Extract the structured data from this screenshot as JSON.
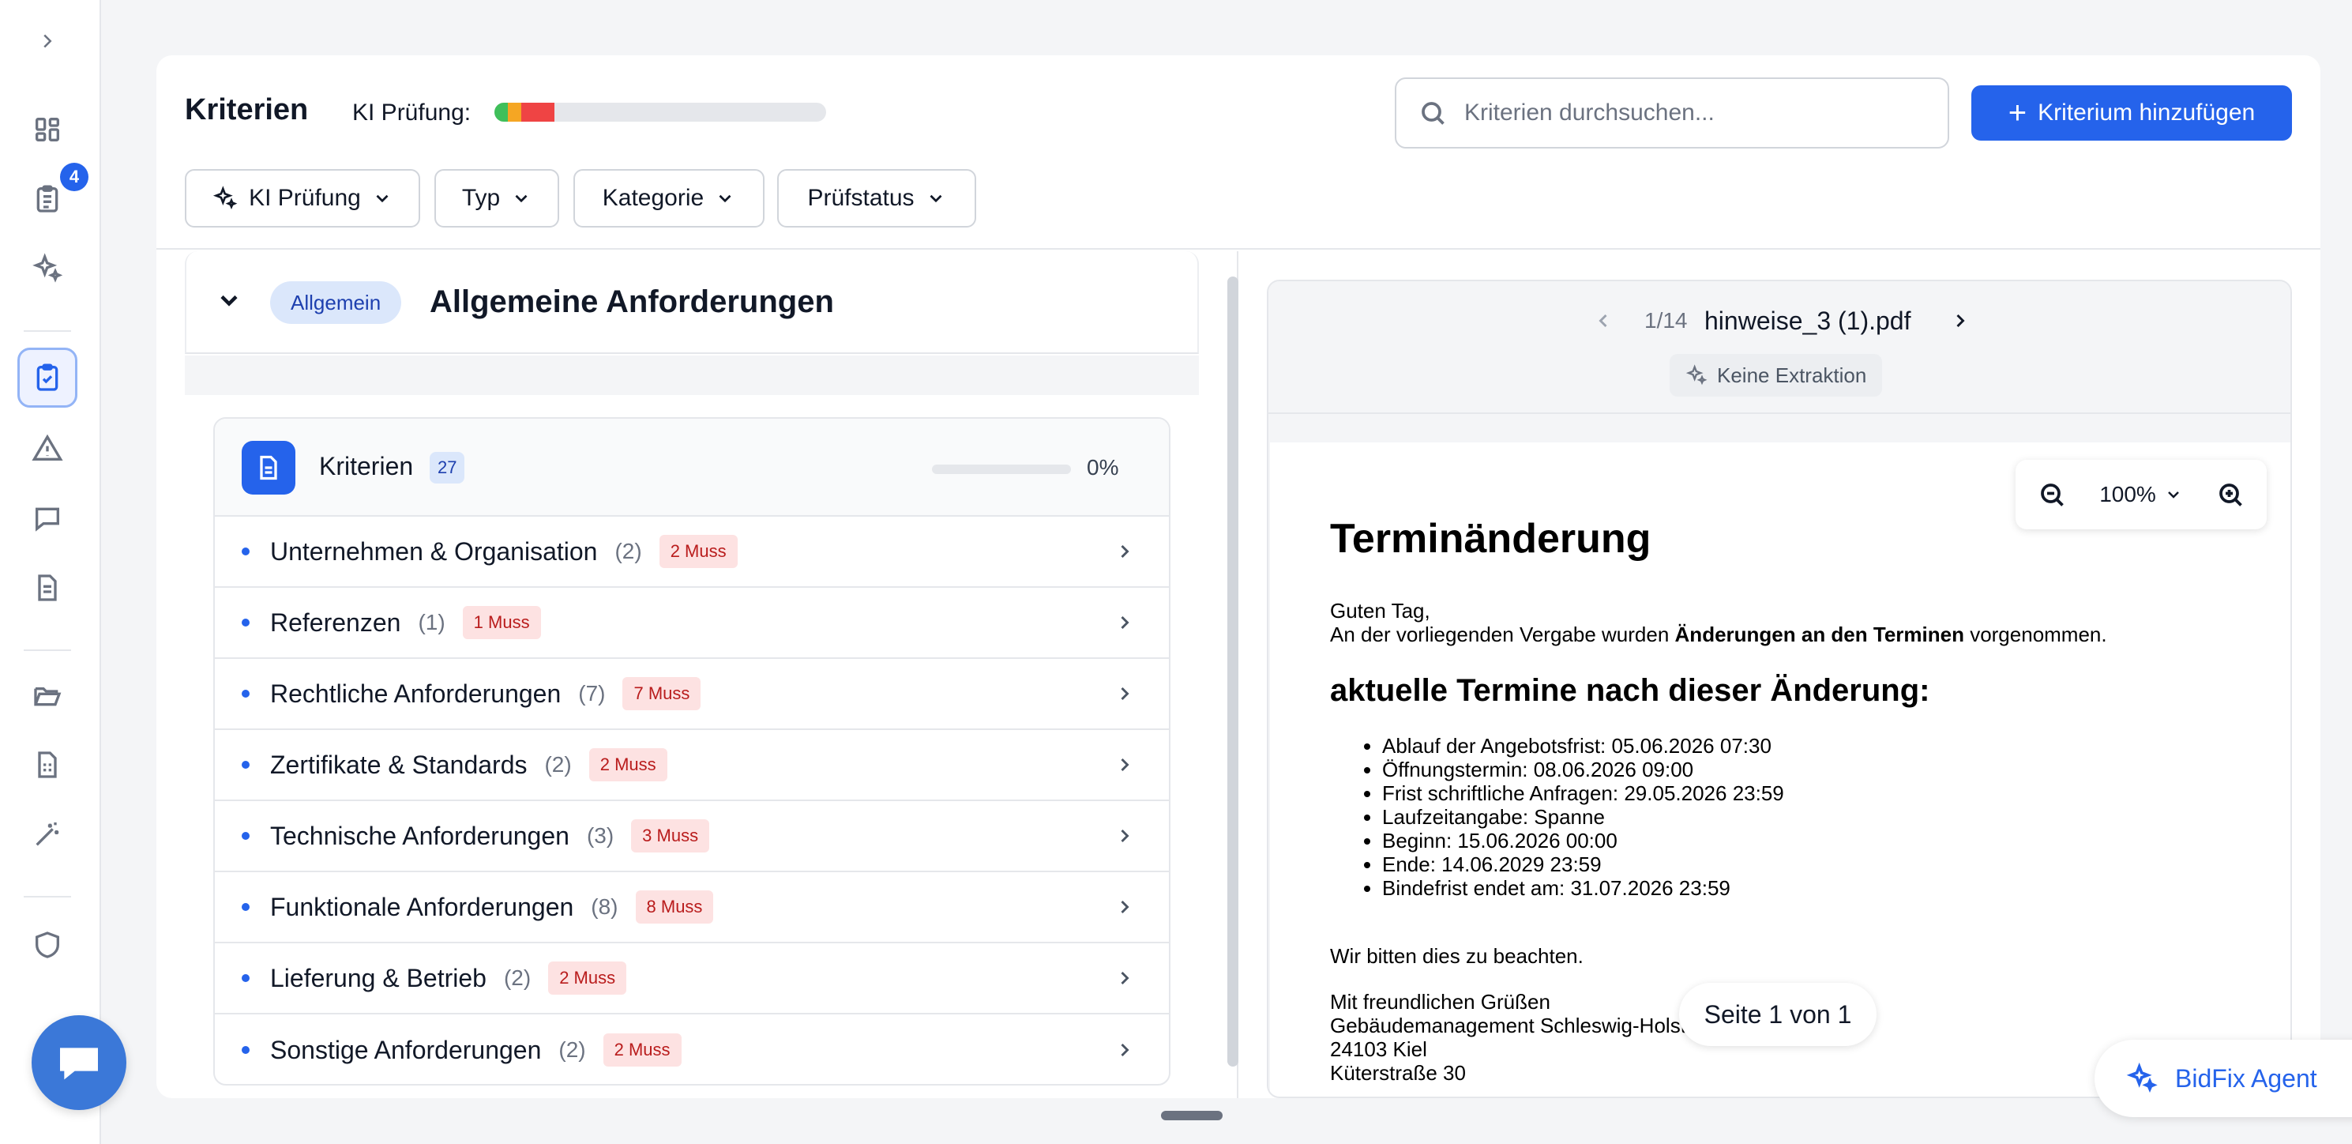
{
  "sidebar": {
    "expand_icon": "chevron-right-icon",
    "badge_count": "4",
    "items": [
      {
        "name": "dashboard-icon"
      },
      {
        "name": "clipboard-list-icon"
      },
      {
        "name": "sparkles-icon"
      },
      {
        "name": "clipboard-check-icon",
        "active": true
      },
      {
        "name": "warning-icon"
      },
      {
        "name": "message-icon"
      },
      {
        "name": "document-icon"
      },
      {
        "name": "folder-open-icon"
      },
      {
        "name": "spreadsheet-icon"
      },
      {
        "name": "magic-wand-icon"
      },
      {
        "name": "shield-icon"
      }
    ]
  },
  "header": {
    "title": "Kriterien",
    "ki_label": "KI Prüfung:",
    "ki_progress": [
      {
        "status": "green",
        "color": "#3fbf5a",
        "fraction": 0.04
      },
      {
        "status": "orange",
        "color": "#f5a623",
        "fraction": 0.04
      },
      {
        "status": "red",
        "color": "#ef4444",
        "fraction": 0.1
      }
    ],
    "search_placeholder": "Kriterien durchsuchen...",
    "add_button_label": "Kriterium hinzufügen"
  },
  "filters": [
    {
      "label": "KI Prüfung",
      "icon": "sparkles-icon"
    },
    {
      "label": "Typ"
    },
    {
      "label": "Kategorie"
    },
    {
      "label": "Prüfstatus"
    }
  ],
  "section": {
    "tag": "Allgemein",
    "title": "Allgemeine Anforderungen"
  },
  "criteria": {
    "title": "Kriterien",
    "count": "27",
    "progress_percent": "0%",
    "progress_fraction": 0,
    "rows": [
      {
        "label": "Unternehmen & Organisation",
        "count": "(2)",
        "muss": "2 Muss"
      },
      {
        "label": "Referenzen",
        "count": "(1)",
        "muss": "1 Muss"
      },
      {
        "label": "Rechtliche Anforderungen",
        "count": "(7)",
        "muss": "7 Muss"
      },
      {
        "label": "Zertifikate & Standards",
        "count": "(2)",
        "muss": "2 Muss"
      },
      {
        "label": "Technische Anforderungen",
        "count": "(3)",
        "muss": "3 Muss"
      },
      {
        "label": "Funktionale Anforderungen",
        "count": "(8)",
        "muss": "8 Muss"
      },
      {
        "label": "Lieferung & Betrieb",
        "count": "(2)",
        "muss": "2 Muss"
      },
      {
        "label": "Sonstige Anforderungen",
        "count": "(2)",
        "muss": "2 Muss"
      }
    ]
  },
  "viewer": {
    "page_indicator": "1/14",
    "file_name": "hinweise_3 (1).pdf",
    "extraction_label": "Keine Extraktion",
    "zoom": "100%",
    "page_footer": "Seite 1 von 1",
    "document": {
      "title": "Terminänderung",
      "greeting": "Guten Tag,",
      "intro_before": "An der vorliegenden Vergabe wurden ",
      "intro_bold": "Änderungen an den Terminen",
      "intro_after": " vorgenommen.",
      "subheading": "aktuelle Termine nach dieser Änderung:",
      "items": [
        "Ablauf der Angebotsfrist: 05.06.2026 07:30",
        "Öffnungstermin: 08.06.2026 09:00",
        "Frist schriftliche Anfragen: 29.05.2026 23:59",
        "Laufzeitangabe: Spanne",
        "Beginn: 15.06.2026 00:00",
        "Ende: 14.06.2029 23:59",
        "Bindefrist endet am: 31.07.2026 23:59"
      ],
      "note": "Wir bitten dies zu beachten.",
      "closing": "Mit freundlichen Grüßen",
      "org": "Gebäudemanagement Schleswig-Holstein",
      "city": "24103 Kiel",
      "street": "Küterstraße 30"
    }
  },
  "agent_button_label": "BidFix Agent"
}
